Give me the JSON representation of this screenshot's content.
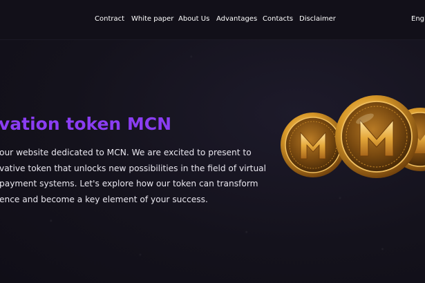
{
  "nav": {
    "items": [
      "Contract",
      "White paper",
      "About Us",
      "Advantages",
      "Contacts",
      "Disclaimer"
    ],
    "language": "Engl"
  },
  "hero": {
    "title": "vation token MCN",
    "paragraph_lines": [
      " our website dedicated to MCN. We are excited to present to",
      "vative token that unlocks new possibilities in the field of virtual",
      "payment systems. Let's explore how our token can transform",
      "ence and become a key element of your success."
    ]
  },
  "coins": {
    "icon": "mcn-gold-coin-icon",
    "symbol": "M",
    "colors": {
      "gold": "#d99a2a",
      "gold_dark": "#7a4a10",
      "gold_light": "#f6c96a"
    }
  },
  "colors": {
    "background": "#14121c",
    "header": "#121019",
    "accent": "#8a3df2",
    "text": "#e9e7ef"
  }
}
